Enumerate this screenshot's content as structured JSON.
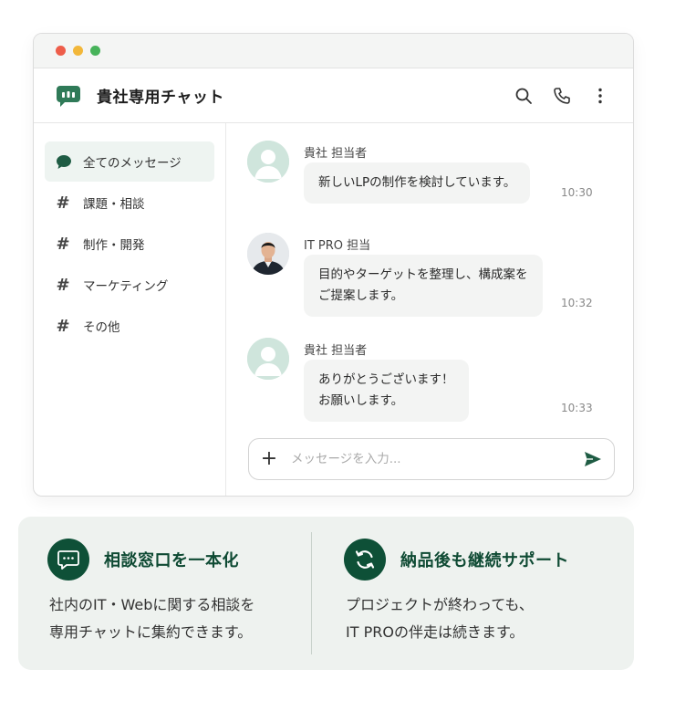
{
  "app": {
    "title": "貴社専用チャット"
  },
  "header_icons": [
    "search-icon",
    "phone-icon",
    "more-vertical-icon"
  ],
  "sidebar": {
    "items": [
      {
        "label": "全てのメッセージ",
        "icon": "chat-bubble-icon",
        "active": true
      },
      {
        "label": "課題・相談",
        "icon": "hash-icon",
        "active": false
      },
      {
        "label": "制作・開発",
        "icon": "hash-icon",
        "active": false
      },
      {
        "label": "マーケティング",
        "icon": "hash-icon",
        "active": false
      },
      {
        "label": "その他",
        "icon": "hash-icon",
        "active": false
      }
    ]
  },
  "messages": [
    {
      "sender": "貴社 担当者",
      "lines": [
        "新しいLPの制作を検討しています。"
      ],
      "time": "10:30"
    },
    {
      "sender": "IT PRO 担当",
      "lines": [
        "目的やターゲットを整理し、構成案を",
        "ご提案します。"
      ],
      "time": "10:32"
    },
    {
      "sender": "貴社 担当者",
      "lines": [
        "ありがとうございます！",
        "お願いします。"
      ],
      "time": "10:33"
    }
  ],
  "composer": {
    "placeholder": "メッセージを入力..."
  },
  "features": [
    {
      "title": "相談窓口を一本化",
      "lines": [
        "社内のIT・Webに関する相談を",
        "専用チャットに集約できます。"
      ],
      "icon": "chat-icon"
    },
    {
      "title": "納品後も継続サポート",
      "lines": [
        "プロジェクトが終わっても、",
        "IT PROの伴走は続きます。"
      ],
      "icon": "refresh-icon"
    }
  ],
  "colors": {
    "brand": "#0e5037",
    "accent_light": "#eef4f1",
    "avatar_placeholder": "#cfe5dc"
  }
}
